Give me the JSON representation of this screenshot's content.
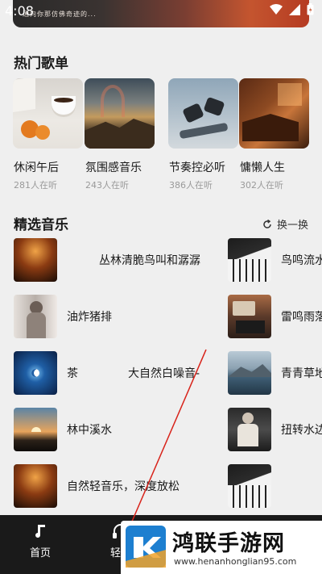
{
  "status_bar": {
    "time": "4:08"
  },
  "banner": {
    "text": "通向你那仿佛奇迹的..."
  },
  "hot_section": {
    "title": "热门歌单"
  },
  "playlists": [
    {
      "name": "休闲午后",
      "count": "281人在听"
    },
    {
      "name": "氛围感音乐",
      "count": "243人在听"
    },
    {
      "name": "节奏控必听",
      "count": "386人在听"
    },
    {
      "name": "慵懒人生",
      "count": "302人在听"
    }
  ],
  "featured_section": {
    "title": "精选音乐",
    "refresh_label": "换一换"
  },
  "tracks_left": [
    {
      "title": "丛林清脆鸟叫和潺潺"
    },
    {
      "title": "油炸猪排"
    },
    {
      "title": "茶"
    },
    {
      "title": "林中溪水"
    },
    {
      "title": "自然轻音乐，深度放松"
    }
  ],
  "track_extra_middle": {
    "title": "大自然白噪音-"
  },
  "tracks_right": [
    {
      "title": "鸟鸣流水"
    },
    {
      "title": "雷鸣雨落"
    },
    {
      "title": "青青草地"
    },
    {
      "title": "扭转水边"
    },
    {
      "title": ""
    }
  ],
  "bottom_nav": [
    {
      "label": "首页",
      "icon": "music-note-icon"
    },
    {
      "label": "轻音",
      "icon": "headphones-icon"
    }
  ],
  "watermark": {
    "title": "鸿联手游网",
    "url": "www.henanhonglian95.com"
  }
}
